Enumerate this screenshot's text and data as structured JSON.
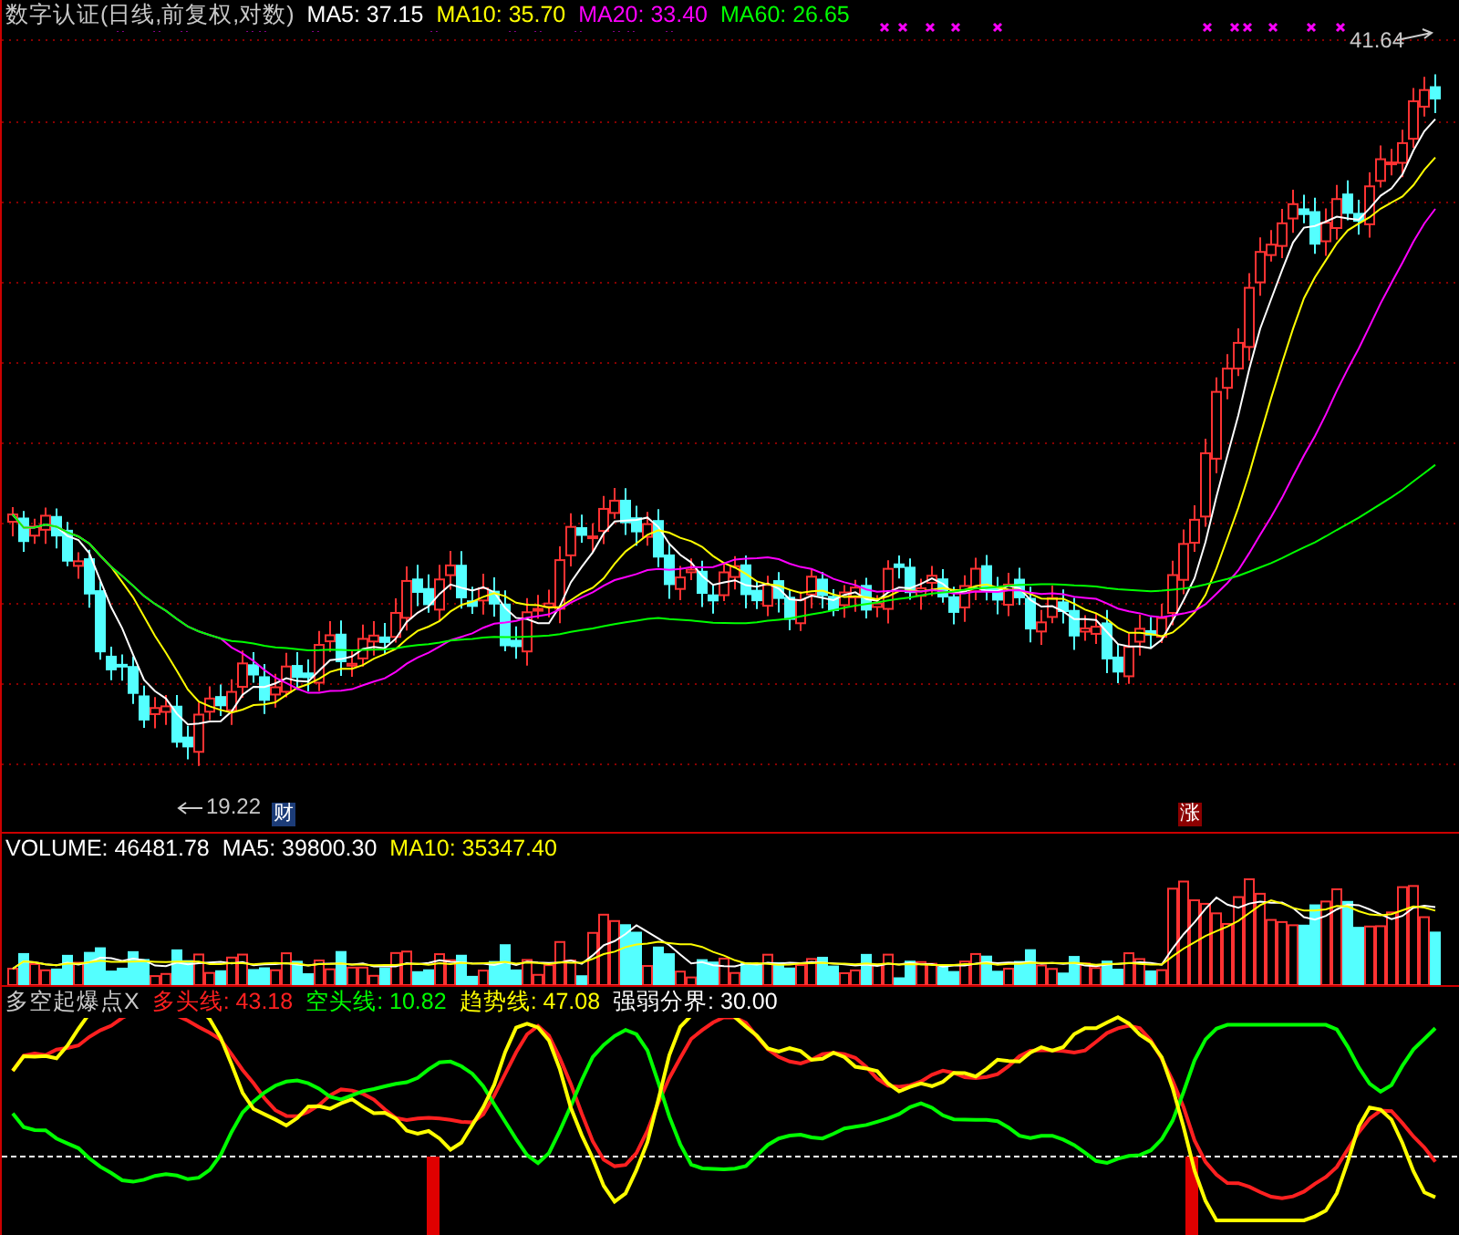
{
  "main_panel": {
    "title": "数字认证(日线,前复权,对数)",
    "indicators": [
      {
        "label": "MA5: 37.15",
        "color": "#ffffff"
      },
      {
        "label": "MA10: 35.70",
        "color": "#ffff00"
      },
      {
        "label": "MA20: 33.40",
        "color": "#ff00ff"
      },
      {
        "label": "MA60: 26.65",
        "color": "#00ff00"
      }
    ],
    "high_label": "41.64",
    "low_label": "19.22",
    "badges": [
      {
        "text": "财",
        "color": "#1c3c78"
      },
      {
        "text": "涨",
        "color": "#8c0000"
      }
    ]
  },
  "volume_panel": {
    "indicators": [
      {
        "label": "VOLUME: 46481.78",
        "color": "#ffffff"
      },
      {
        "label": "MA5: 39800.30",
        "color": "#ffffff"
      },
      {
        "label": "MA10: 35347.40",
        "color": "#ffff00"
      }
    ]
  },
  "signal_panel": {
    "name": "多空起爆点X",
    "indicators": [
      {
        "label": "多头线: 43.18",
        "color": "#ff2020"
      },
      {
        "label": "空头线: 10.82",
        "color": "#00ff00"
      },
      {
        "label": "趋势线: 47.08",
        "color": "#ffff00"
      },
      {
        "label": "强弱分界: 30.00",
        "color": "#ffffff"
      }
    ]
  }
}
